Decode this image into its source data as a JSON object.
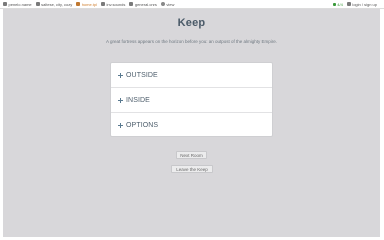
{
  "topbar": {
    "items": [
      {
        "label": "penelo.name",
        "icon": "user-icon"
      },
      {
        "label": "saltese, city, cozy",
        "icon": "location-icon"
      },
      {
        "label": "home.tpl",
        "icon": "room-icon",
        "current": true
      },
      {
        "label": "inv.sounds",
        "icon": "inventory-icon"
      },
      {
        "label": "general.cnrs",
        "icon": "general-icon"
      },
      {
        "label": "view",
        "icon": "globe-icon"
      }
    ],
    "health": "4/4",
    "session": "login / sign up"
  },
  "page": {
    "title": "Keep",
    "description": "A great fortress appears on the horizon before you: an outpost of the almighty Empire."
  },
  "sections": [
    {
      "label": "OUTSIDE"
    },
    {
      "label": "INSIDE"
    },
    {
      "label": "OPTIONS"
    }
  ],
  "buttons": {
    "next_room": "Next Room",
    "leave_keep": "Leave the Keep"
  },
  "colors": {
    "background": "#d8d7da",
    "panel": "#ffffff",
    "accent": "#d08030",
    "health": "#3a9a3a"
  }
}
